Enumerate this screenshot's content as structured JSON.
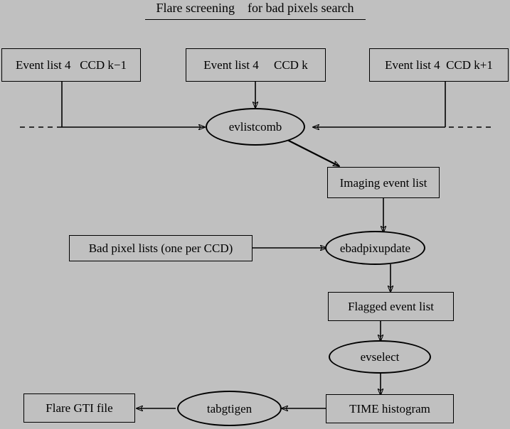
{
  "diagram": {
    "title": "Flare screening    for bad pixels search",
    "background_color": "#c0c0c0",
    "line_color": "#000000",
    "nodes": {
      "event_list_ccd_km1": "Event list 4   CCD k−1",
      "event_list_ccd_k": "Event list 4     CCD k",
      "event_list_ccd_kp1": "Event list 4  CCD k+1",
      "evlistcomb": "evlistcomb",
      "imaging_event_list": "Imaging event list",
      "bad_pixel_lists": "Bad pixel lists (one per CCD)",
      "ebadpixupdate": "ebadpixupdate",
      "flagged_event_list": "Flagged event list",
      "evselect": "evselect",
      "time_histogram": "TIME histogram",
      "tabgtigen": "tabgtigen",
      "flare_gti_file": "Flare GTI file"
    }
  }
}
